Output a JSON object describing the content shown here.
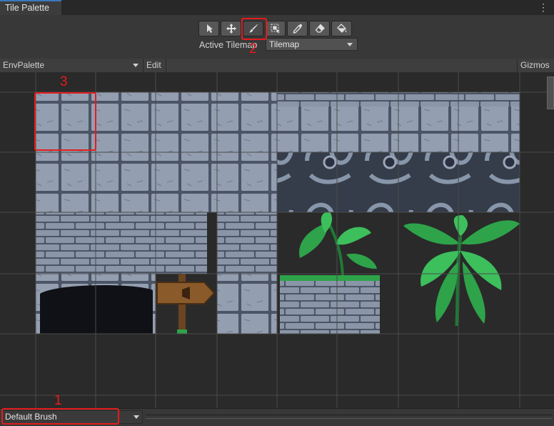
{
  "window": {
    "tab_title": "Tile Palette",
    "menu_icon": "kebab-menu-icon"
  },
  "toolbar": {
    "tools": [
      {
        "name": "select-tool",
        "icon": "arrow-cursor-icon"
      },
      {
        "name": "move-tool",
        "icon": "move-arrows-icon"
      },
      {
        "name": "paint-tool",
        "icon": "paintbrush-icon"
      },
      {
        "name": "box-fill-tool",
        "icon": "box-select-icon"
      },
      {
        "name": "picker-tool",
        "icon": "eyedropper-icon"
      },
      {
        "name": "erase-tool",
        "icon": "eraser-icon"
      },
      {
        "name": "fill-tool",
        "icon": "paint-bucket-icon"
      }
    ],
    "active_tool": "paint-tool",
    "active_tilemap_label": "Active Tilemap",
    "active_tilemap_value": "Tilemap"
  },
  "palette_bar": {
    "palette_name": "EnvPalette",
    "edit_label": "Edit",
    "gizmos_label": "Gizmos"
  },
  "bottom": {
    "brush_value": "Default Brush"
  },
  "annotations": {
    "marker_1": "1",
    "marker_2": "2",
    "marker_3": "3",
    "color": "#e51c1c"
  },
  "colors": {
    "grid_line": "#4b4b4b",
    "stone": "#8a96a8",
    "stone_dark": "#4b5566",
    "leaf": "#2ea34a",
    "wood": "#8a5a2b"
  }
}
